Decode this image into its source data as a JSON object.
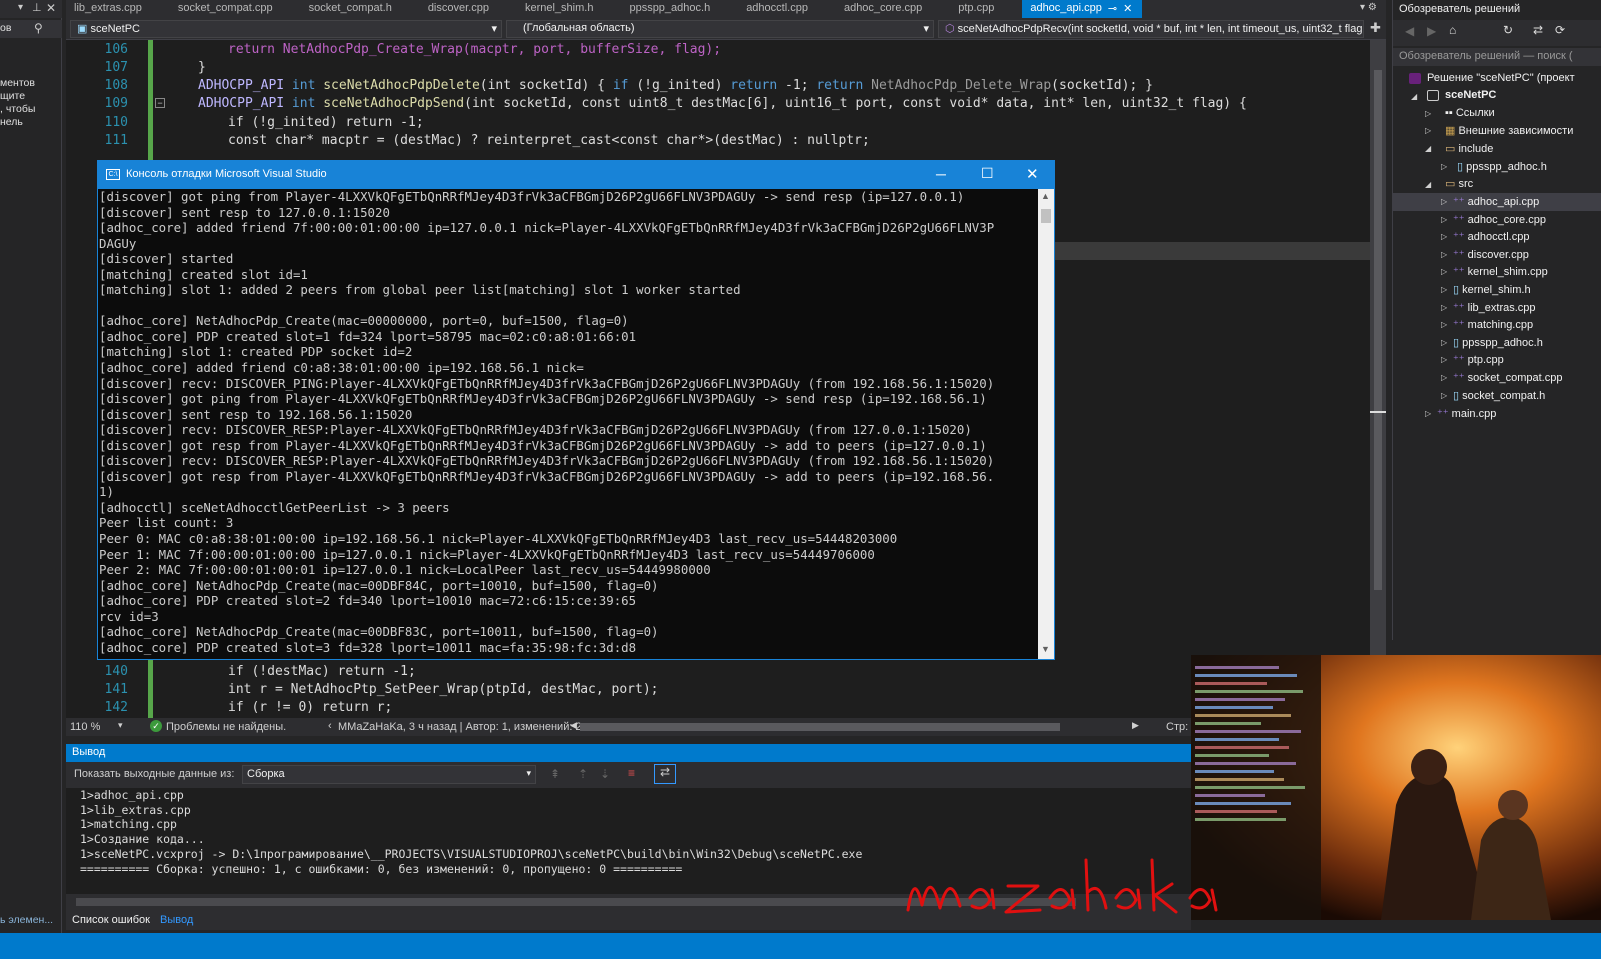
{
  "left_panel": {
    "lines": [
      "ов",
      "ментов",
      "щите",
      ", чтобы",
      "нель"
    ],
    "bottom_text": "ь элемен..."
  },
  "tabs": [
    {
      "label": "lib_extras.cpp"
    },
    {
      "label": "socket_compat.cpp"
    },
    {
      "label": "socket_compat.h"
    },
    {
      "label": "discover.cpp"
    },
    {
      "label": "kernel_shim.h"
    },
    {
      "label": "ppsspp_adhoc.h"
    },
    {
      "label": "adhocctl.cpp"
    },
    {
      "label": "adhoc_core.cpp"
    },
    {
      "label": "ptp.cpp"
    },
    {
      "label": "adhoc_api.cpp",
      "active": true
    }
  ],
  "navbar": {
    "project": "sceNetPC",
    "scope": "(Глобальная область)",
    "member": "sceNetAdhocPdpRecv(int socketId, void * buf, int * len, int timeout_us, uint32_t flag"
  },
  "editor": {
    "lines_top": [
      {
        "n": "106"
      },
      {
        "n": "107"
      },
      {
        "n": "108"
      },
      {
        "n": "109"
      },
      {
        "n": "110"
      },
      {
        "n": "111"
      }
    ],
    "lines_bottom": [
      {
        "n": "140"
      },
      {
        "n": "141"
      },
      {
        "n": "142"
      }
    ],
    "code": {
      "l106": "return NetAdhocPdp_Create_Wrap(macptr, port, bufferSize, flag);",
      "l107": "}",
      "l108_macro": "ADHOCPP_API",
      "l108_int": "int",
      "l108_fn": "sceNetAdhocPdpDelete",
      "l108_rest1": "(int socketId) { ",
      "l108_if": "if",
      "l108_rest2": " (!g_inited) ",
      "l108_ret": "return",
      "l108_rest3": " -1; ",
      "l108_ret2": "return",
      "l108_fn2": "NetAdhocPdp_Delete_Wrap",
      "l108_rest4": "(socketId); }",
      "l109_macro": "ADHOCPP_API",
      "l109_int": "int",
      "l109_fn": "sceNetAdhocPdpSend",
      "l109_rest": "(int socketId, const uint8_t destMac[6], uint16_t port, const void* data, int* len, uint32_t flag) {",
      "l110": "if (!g_inited) return -1;",
      "l111": "const char* macptr = (destMac) ? reinterpret_cast<const char*>(destMac) : nullptr;",
      "l140": "if (!destMac) return -1;",
      "l141": "int r = NetAdhocPtp_SetPeer_Wrap(ptpId, destMac, port);",
      "l142": "if (r != 0) return r;"
    }
  },
  "editor_status": {
    "zoom": "110 %",
    "problems": "Проблемы не найдены.",
    "git": "MMaZaHaKa, 3 ч назад | Автор: 1, изменений: 2",
    "line_label": "Стр:"
  },
  "output": {
    "title": "Вывод",
    "show_from_label": "Показать выходные данные из:",
    "source": "Сборка",
    "lines": [
      "1>adhoc_api.cpp",
      "1>lib_extras.cpp",
      "1>matching.cpp",
      "1>Создание кода...",
      "1>sceNetPC.vcxproj -> D:\\1програмирование\\__PROJECTS\\VISUALSTUDIOPROJ\\sceNetPC\\build\\bin\\Win32\\Debug\\sceNetPC.exe",
      "========== Сборка: успешно: 1, с ошибками: 0, без изменений: 0, пропущено: 0 =========="
    ]
  },
  "bottom_tabs": [
    {
      "label": "Список ошибок"
    },
    {
      "label": "Вывод",
      "active": true
    }
  ],
  "solution_explorer": {
    "title": "Обозреватель решений",
    "search_placeholder": "Обозреватель решений — поиск (",
    "solution": "Решение \"sceNetPC\" (проект",
    "project": "sceNetPC",
    "refs": "Ссылки",
    "external": "Внешние зависимости",
    "include_folder": "include",
    "include_files": [
      "ppsspp_adhoc.h"
    ],
    "src_folder": "src",
    "src_files": [
      "adhoc_api.cpp",
      "adhoc_core.cpp",
      "adhocctl.cpp",
      "discover.cpp",
      "kernel_shim.cpp",
      "kernel_shim.h",
      "lib_extras.cpp",
      "matching.cpp",
      "ppsspp_adhoc.h",
      "ptp.cpp",
      "socket_compat.cpp",
      "socket_compat.h"
    ],
    "main": "main.cpp"
  },
  "console": {
    "title": "Консоль отладки Microsoft Visual Studio",
    "lines": [
      "[discover] got ping from Player-4LXXVkQFgETbQnRRfMJey4D3frVk3aCFBGmjD26P2gU66FLNV3PDAGUy -> send resp (ip=127.0.0.1)",
      "[discover] sent resp to 127.0.0.1:15020",
      "[adhoc_core] added friend 7f:00:00:01:00:00 ip=127.0.0.1 nick=Player-4LXXVkQFgETbQnRRfMJey4D3frVk3aCFBGmjD26P2gU66FLNV3P",
      "DAGUy",
      "[discover] started",
      "[matching] created slot id=1",
      "[matching] slot 1: added 2 peers from global peer list[matching] slot 1 worker started",
      "",
      "[adhoc_core] NetAdhocPdp_Create(mac=00000000, port=0, buf=1500, flag=0)",
      "[adhoc_core] PDP created slot=1 fd=324 lport=58795 mac=02:c0:a8:01:66:01",
      "[matching] slot 1: created PDP socket id=2",
      "[adhoc_core] added friend c0:a8:38:01:00:00 ip=192.168.56.1 nick=",
      "[discover] recv: DISCOVER_PING:Player-4LXXVkQFgETbQnRRfMJey4D3frVk3aCFBGmjD26P2gU66FLNV3PDAGUy (from 192.168.56.1:15020)",
      "[discover] got ping from Player-4LXXVkQFgETbQnRRfMJey4D3frVk3aCFBGmjD26P2gU66FLNV3PDAGUy -> send resp (ip=192.168.56.1)",
      "[discover] sent resp to 192.168.56.1:15020",
      "[discover] recv: DISCOVER_RESP:Player-4LXXVkQFgETbQnRRfMJey4D3frVk3aCFBGmjD26P2gU66FLNV3PDAGUy (from 127.0.0.1:15020)",
      "[discover] got resp from Player-4LXXVkQFgETbQnRRfMJey4D3frVk3aCFBGmjD26P2gU66FLNV3PDAGUy -> add to peers (ip=127.0.0.1)",
      "[discover] recv: DISCOVER_RESP:Player-4LXXVkQFgETbQnRRfMJey4D3frVk3aCFBGmjD26P2gU66FLNV3PDAGUy (from 192.168.56.1:15020)",
      "[discover] got resp from Player-4LXXVkQFgETbQnRRfMJey4D3frVk3aCFBGmjD26P2gU66FLNV3PDAGUy -> add to peers (ip=192.168.56.",
      "1)",
      "[adhocctl] sceNetAdhocctlGetPeerList -> 3 peers",
      "Peer list count: 3",
      "Peer 0: MAC c0:a8:38:01:00:00 ip=192.168.56.1 nick=Player-4LXXVkQFgETbQnRRfMJey4D3 last_recv_us=54448203000",
      "Peer 1: MAC 7f:00:00:01:00:00 ip=127.0.0.1 nick=Player-4LXXVkQFgETbQnRRfMJey4D3 last_recv_us=54449706000",
      "Peer 2: MAC 7f:00:00:01:00:01 ip=127.0.0.1 nick=LocalPeer last_recv_us=54449980000",
      "[adhoc_core] NetAdhocPdp_Create(mac=00DBF84C, port=10010, buf=1500, flag=0)",
      "[adhoc_core] PDP created slot=2 fd=340 lport=10010 mac=72:c6:15:ce:39:65",
      "rcv id=3",
      "[adhoc_core] NetAdhocPdp_Create(mac=00DBF83C, port=10011, buf=1500, flag=0)",
      "[adhoc_core] PDP created slot=3 fd=328 lport=10011 mac=fa:35:98:fc:3d:d8"
    ]
  },
  "watermark": "mazahaka",
  "colors": {
    "accent": "#007acc",
    "console_title": "#1883d7",
    "watermark": "#e01010"
  }
}
